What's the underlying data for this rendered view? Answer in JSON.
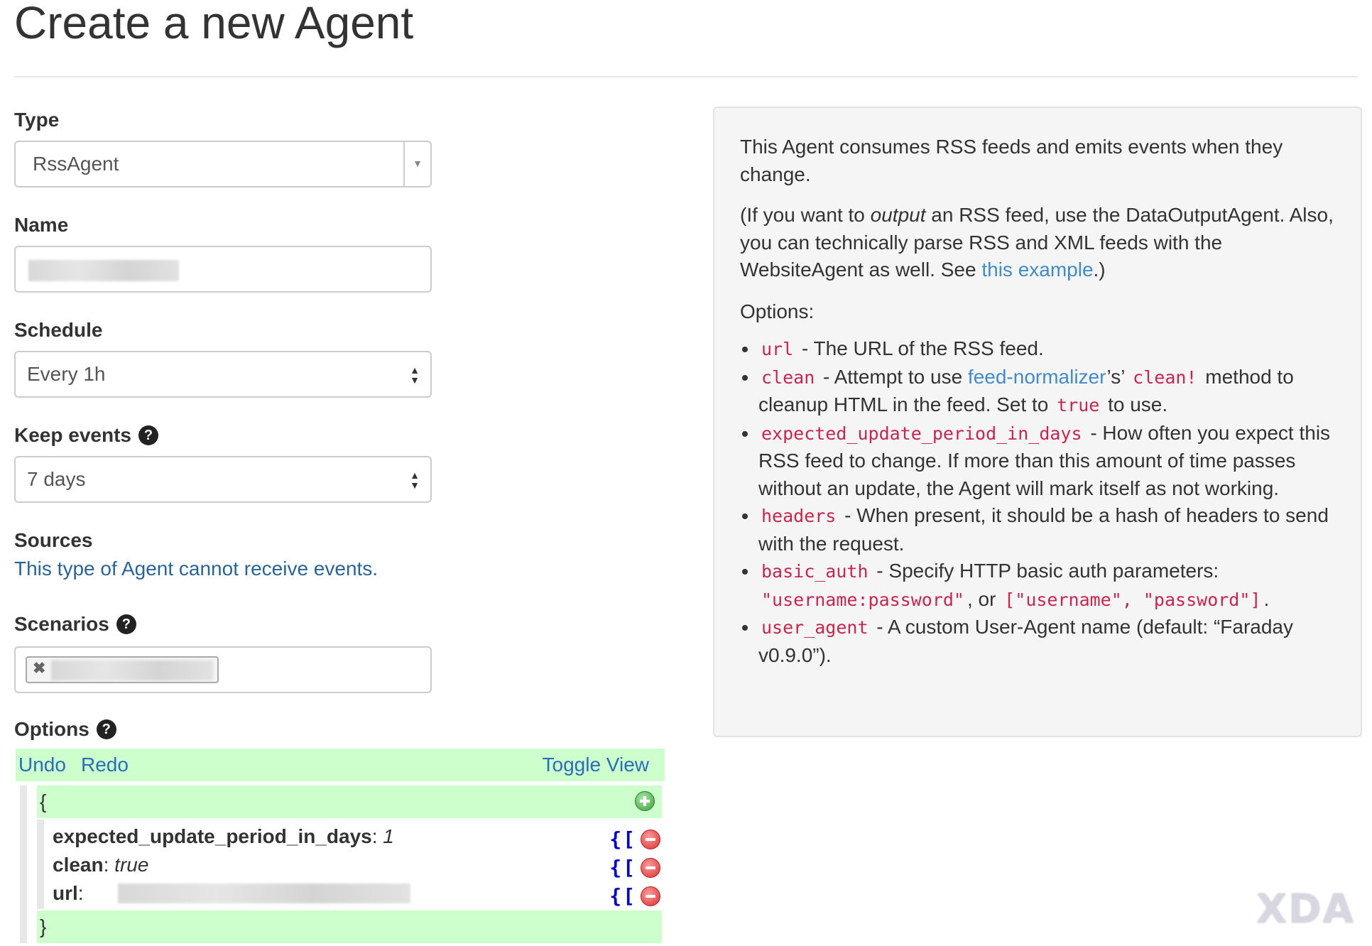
{
  "page": {
    "title": "Create a new Agent"
  },
  "form": {
    "type": {
      "label": "Type",
      "value": "RssAgent"
    },
    "name": {
      "label": "Name",
      "value": ""
    },
    "schedule": {
      "label": "Schedule",
      "value": "Every 1h"
    },
    "keep_events": {
      "label": "Keep events",
      "value": "7 days"
    },
    "sources": {
      "label": "Sources",
      "text": "This type of Agent cannot receive events."
    },
    "scenarios": {
      "label": "Scenarios"
    },
    "options": {
      "label": "Options",
      "menu": {
        "undo": "Undo",
        "redo": "Redo",
        "toggle": "Toggle View"
      },
      "open_brace": "{",
      "close_brace": "}",
      "rows": [
        {
          "key": "expected_update_period_in_days",
          "sep": ":",
          "value": "1"
        },
        {
          "key": "clean",
          "sep": ":",
          "value": "true"
        },
        {
          "key": "url",
          "sep": ":",
          "value": ""
        }
      ],
      "brace_buttons": "{["
    }
  },
  "help": {
    "intro": "This Agent consumes RSS feeds and emits events when they change.",
    "para2": {
      "before": "(If you want to ",
      "em": "output",
      "mid": " an RSS feed, use the DataOutputAgent. Also, you can technically parse RSS and XML feeds with the WebsiteAgent as well. See ",
      "link": "this example",
      "after": ".)"
    },
    "options_heading": "Options:",
    "items": {
      "url": {
        "code": "url",
        "text": " - The URL of the RSS feed."
      },
      "clean": {
        "code": "clean",
        "text1": " - Attempt to use ",
        "link": "feed-normalizer",
        "text2": "’s’ ",
        "code2": "clean!",
        "text3": " method to cleanup HTML in the feed. Set to ",
        "code3": "true",
        "text4": " to use."
      },
      "expected": {
        "code": "expected_update_period_in_days",
        "text": " - How often you expect this RSS feed to change. If more than this amount of time passes without an update, the Agent will mark itself as not working."
      },
      "headers": {
        "code": "headers",
        "text": " - When present, it should be a hash of headers to send with the request."
      },
      "basic_auth": {
        "code": "basic_auth",
        "text1": " - Specify HTTP basic auth parameters: ",
        "code2": "\"username:password\"",
        "text2": ", or ",
        "code3": "[\"username\", \"password\"]",
        "text3": "."
      },
      "user_agent": {
        "code": "user_agent",
        "text": " - A custom User-Agent name (default: “Faraday v0.9.0”)."
      }
    }
  },
  "watermark": "XDA",
  "colors": {
    "link": "#428bca",
    "sources_link": "#2a6496",
    "code": "#c7254e",
    "editor_green": "#ccffcc"
  },
  "icons": [
    "help-icon",
    "caret-down-icon",
    "updown-arrows-icon",
    "tag-remove-icon",
    "add-icon",
    "remove-icon"
  ]
}
